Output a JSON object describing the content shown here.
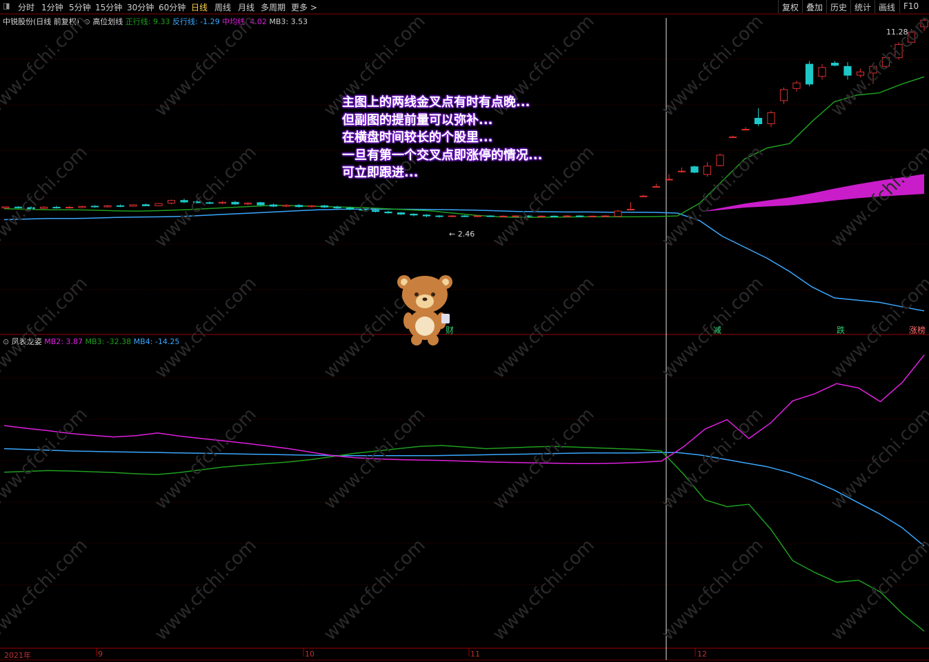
{
  "toolbar": {
    "periods": [
      "分时",
      "1分钟",
      "5分钟",
      "15分钟",
      "30分钟",
      "60分钟",
      "日线",
      "周线",
      "月线",
      "多周期",
      "更多 >"
    ],
    "active_period": "日线",
    "right_buttons": [
      "复权",
      "叠加",
      "历史",
      "统计",
      "画线",
      "F10"
    ]
  },
  "main_legend": {
    "stock": "中锐股份(日线 前复权)",
    "indicator": "高位划线",
    "items": [
      {
        "label": "正行线: 9.33",
        "color": "#1fa01f"
      },
      {
        "label": "反行线: -1.29",
        "color": "#3aa8ff"
      },
      {
        "label": "中均线: 4.02",
        "color": "#e020e0"
      },
      {
        "label": "MB3: 3.53",
        "color": "#cfcfcf"
      }
    ]
  },
  "sub_legend": {
    "indicator": "凤表龙姿",
    "items": [
      {
        "label": "MB2: 3.87",
        "color": "#e020e0"
      },
      {
        "label": "MB3: -32.38",
        "color": "#1fa01f"
      },
      {
        "label": "MB4: -14.25",
        "color": "#3aa8ff"
      }
    ]
  },
  "annotation": [
    "主图上的两线金叉点有时有点晚...",
    "但副图的提前量可以弥补...",
    "在横盘时间较长的个股里...",
    "一旦有第一个交叉点即涨停的情况...",
    "可立即跟进..."
  ],
  "price_labels": {
    "high": "11.28",
    "low": "2.46"
  },
  "signals": [
    "财",
    "减",
    "跌",
    "涨榜"
  ],
  "date_axis": [
    "2021年",
    "9",
    "10",
    "11",
    "12"
  ],
  "colors": {
    "up": "#e03030",
    "down": "#1fc8c8",
    "green": "#1fa01f",
    "blue": "#3aa8ff",
    "magenta": "#e020e0",
    "grid": "#5a0000"
  },
  "chart_data": [
    {
      "type": "line",
      "title": "高位划线",
      "series": [
        {
          "name": "正行线",
          "values": [
            3.35,
            3.32,
            3.3,
            3.3,
            3.28,
            3.25,
            3.24,
            3.26,
            3.3,
            3.35,
            3.4,
            3.45,
            3.5,
            3.48,
            3.45,
            3.42,
            3.4,
            3.35,
            3.3,
            3.25,
            3.15,
            3.05,
            2.98,
            2.95,
            2.96,
            2.97,
            2.98,
            2.98,
            2.98,
            2.99,
            3.02,
            3.6,
            4.6,
            5.6,
            6.1,
            6.3,
            7.3,
            8.2,
            8.5,
            8.6,
            9.0,
            9.33
          ]
        },
        {
          "name": "反行线",
          "values": [
            2.85,
            2.88,
            2.9,
            2.9,
            2.92,
            2.95,
            2.97,
            2.98,
            3.0,
            3.05,
            3.1,
            3.15,
            3.2,
            3.25,
            3.3,
            3.32,
            3.33,
            3.33,
            3.32,
            3.31,
            3.3,
            3.28,
            3.25,
            3.22,
            3.21,
            3.2,
            3.2,
            3.19,
            3.19,
            3.18,
            3.15,
            2.8,
            2.1,
            1.6,
            1.1,
            0.5,
            -0.2,
            -0.7,
            -0.8,
            -0.9,
            -1.1,
            -1.29
          ]
        },
        {
          "name": "中均线",
          "values": [
            3.0,
            3.02,
            3.05,
            3.07,
            3.1,
            3.12,
            3.13,
            3.15,
            3.18,
            3.2,
            3.22,
            3.23,
            3.24,
            3.25,
            3.25,
            3.24,
            3.23,
            3.22,
            3.2,
            3.19,
            3.17,
            3.15,
            3.13,
            3.11,
            3.1,
            3.1,
            3.1,
            3.1,
            3.1,
            3.1,
            3.12,
            3.2,
            3.3,
            3.4,
            3.45,
            3.5,
            3.6,
            3.72,
            3.82,
            3.9,
            3.96,
            4.02
          ]
        }
      ],
      "ylim": [
        -2.2,
        12.0
      ]
    },
    {
      "type": "line",
      "title": "凤表龙姿",
      "series": [
        {
          "name": "MB2",
          "values": [
            16.5,
            15.8,
            15.2,
            14.5,
            14.0,
            13.6,
            13.9,
            14.6,
            13.8,
            13.2,
            12.6,
            12.0,
            11.3,
            10.6,
            9.7,
            8.8,
            8.3,
            8.0,
            7.8,
            7.7,
            7.6,
            7.4,
            7.2,
            7.1,
            7.0,
            6.9,
            6.8,
            6.8,
            6.9,
            7.1,
            7.4,
            11.0,
            15.6,
            18.0,
            13.2,
            17.2,
            22.8,
            24.6,
            27.2,
            26.1,
            22.6,
            27.5,
            34.5
          ]
        },
        {
          "name": "MB3",
          "values": [
            4.6,
            4.8,
            5.0,
            4.9,
            4.7,
            4.5,
            4.2,
            4.0,
            4.5,
            5.2,
            5.9,
            6.4,
            6.8,
            7.2,
            7.8,
            8.6,
            9.4,
            10.0,
            10.6,
            11.2,
            11.4,
            11.0,
            10.6,
            10.8,
            11.0,
            11.2,
            11.0,
            10.8,
            10.6,
            10.4,
            10.0,
            4.2,
            -2.5,
            -4.2,
            -3.6,
            -10.0,
            -18.0,
            -21.0,
            -23.5,
            -23.0,
            -26.0,
            -31.5,
            -36.0
          ]
        },
        {
          "name": "MB4",
          "values": [
            10.6,
            10.4,
            10.2,
            10.0,
            9.9,
            9.8,
            9.7,
            9.6,
            9.5,
            9.4,
            9.3,
            9.2,
            9.1,
            9.0,
            8.9,
            8.8,
            8.8,
            8.8,
            8.8,
            8.8,
            8.9,
            9.0,
            9.1,
            9.2,
            9.3,
            9.4,
            9.5,
            9.5,
            9.5,
            9.6,
            9.6,
            9.0,
            8.0,
            7.0,
            6.0,
            4.5,
            2.5,
            0.0,
            -3.0,
            -6.0,
            -9.5,
            -14.25
          ]
        }
      ],
      "ylim": [
        -40,
        38
      ]
    },
    {
      "type": "candlestick",
      "title": "中锐股份",
      "candles": [
        [
          3.38,
          3.43,
          3.45,
          3.33
        ],
        [
          3.42,
          3.39,
          3.46,
          3.36
        ],
        [
          3.4,
          3.35,
          3.45,
          3.33
        ],
        [
          3.36,
          3.42,
          3.46,
          3.33
        ],
        [
          3.41,
          3.38,
          3.48,
          3.35
        ],
        [
          3.39,
          3.41,
          3.47,
          3.36
        ],
        [
          3.4,
          3.45,
          3.48,
          3.37
        ],
        [
          3.46,
          3.43,
          3.5,
          3.39
        ],
        [
          3.43,
          3.48,
          3.52,
          3.4
        ],
        [
          3.48,
          3.46,
          3.54,
          3.42
        ],
        [
          3.46,
          3.52,
          3.55,
          3.44
        ],
        [
          3.53,
          3.48,
          3.58,
          3.46
        ],
        [
          3.48,
          3.58,
          3.6,
          3.46
        ],
        [
          3.6,
          3.72,
          3.76,
          3.55
        ],
        [
          3.72,
          3.65,
          3.8,
          3.6
        ],
        [
          3.66,
          3.62,
          3.72,
          3.58
        ],
        [
          3.62,
          3.6,
          3.68,
          3.56
        ],
        [
          3.6,
          3.64,
          3.7,
          3.55
        ],
        [
          3.64,
          3.56,
          3.7,
          3.52
        ],
        [
          3.56,
          3.6,
          3.64,
          3.5
        ],
        [
          3.62,
          3.52,
          3.66,
          3.48
        ],
        [
          3.52,
          3.46,
          3.58,
          3.42
        ],
        [
          3.46,
          3.5,
          3.56,
          3.42
        ],
        [
          3.5,
          3.44,
          3.56,
          3.4
        ],
        [
          3.44,
          3.48,
          3.52,
          3.4
        ],
        [
          3.48,
          3.42,
          3.52,
          3.38
        ],
        [
          3.42,
          3.38,
          3.48,
          3.34
        ],
        [
          3.38,
          3.32,
          3.44,
          3.28
        ],
        [
          3.32,
          3.28,
          3.38,
          3.24
        ],
        [
          3.28,
          3.22,
          3.34,
          3.18
        ],
        [
          3.2,
          3.16,
          3.26,
          3.12
        ],
        [
          3.16,
          3.1,
          3.2,
          3.06
        ],
        [
          3.1,
          3.06,
          3.14,
          3.0
        ],
        [
          3.06,
          3.02,
          3.1,
          2.96
        ],
        [
          3.02,
          3.0,
          3.06,
          2.94
        ],
        [
          3.0,
          3.02,
          3.06,
          2.96
        ],
        [
          3.02,
          3.0,
          3.06,
          2.96
        ],
        [
          3.0,
          3.02,
          3.06,
          2.96
        ],
        [
          3.02,
          3.0,
          3.05,
          2.97
        ],
        [
          3.0,
          3.01,
          3.04,
          2.96
        ],
        [
          3.0,
          3.02,
          3.05,
          2.97
        ],
        [
          3.02,
          3.0,
          3.05,
          2.97
        ],
        [
          3.0,
          3.01,
          3.04,
          2.96
        ],
        [
          3.01,
          3.0,
          3.04,
          2.96
        ],
        [
          3.0,
          3.02,
          3.05,
          2.97
        ],
        [
          3.02,
          3.0,
          3.05,
          2.96
        ],
        [
          3.0,
          3.01,
          3.04,
          2.96
        ],
        [
          3.01,
          3.02,
          3.05,
          2.97
        ],
        [
          3.0,
          3.24,
          3.3,
          2.98
        ],
        [
          3.32,
          3.32,
          3.65,
          3.28
        ],
        [
          3.9,
          3.92,
          3.98,
          3.88
        ],
        [
          4.35,
          4.35,
          4.48,
          4.3
        ],
        [
          4.68,
          4.68,
          4.92,
          4.62
        ],
        [
          5.05,
          5.05,
          5.22,
          4.98
        ],
        [
          5.25,
          5.0,
          5.3,
          4.95
        ],
        [
          4.9,
          5.28,
          5.45,
          4.8
        ],
        [
          5.3,
          5.78,
          5.85,
          5.26
        ],
        [
          6.6,
          6.6,
          6.66,
          6.56
        ],
        [
          6.95,
          6.95,
          7.05,
          6.9
        ],
        [
          7.45,
          7.2,
          7.9,
          7.1
        ],
        [
          7.2,
          7.7,
          7.8,
          7.05
        ],
        [
          8.25,
          8.75,
          8.85,
          8.1
        ],
        [
          8.8,
          9.05,
          9.15,
          8.65
        ],
        [
          9.9,
          9.0,
          10.05,
          8.9
        ],
        [
          9.35,
          9.75,
          9.9,
          9.2
        ],
        [
          9.95,
          9.85,
          10.05,
          9.8
        ],
        [
          9.8,
          9.4,
          10.0,
          9.2
        ],
        [
          9.4,
          9.55,
          9.7,
          9.3
        ],
        [
          9.5,
          9.8,
          9.95,
          9.0
        ],
        [
          9.8,
          10.2,
          10.3,
          9.7
        ],
        [
          10.2,
          10.8,
          10.9,
          10.1
        ],
        [
          10.9,
          11.35,
          11.5,
          10.8
        ],
        [
          11.6,
          11.9,
          12.0,
          11.4
        ]
      ],
      "candle_fields": [
        "open",
        "close",
        "high",
        "low"
      ]
    }
  ]
}
